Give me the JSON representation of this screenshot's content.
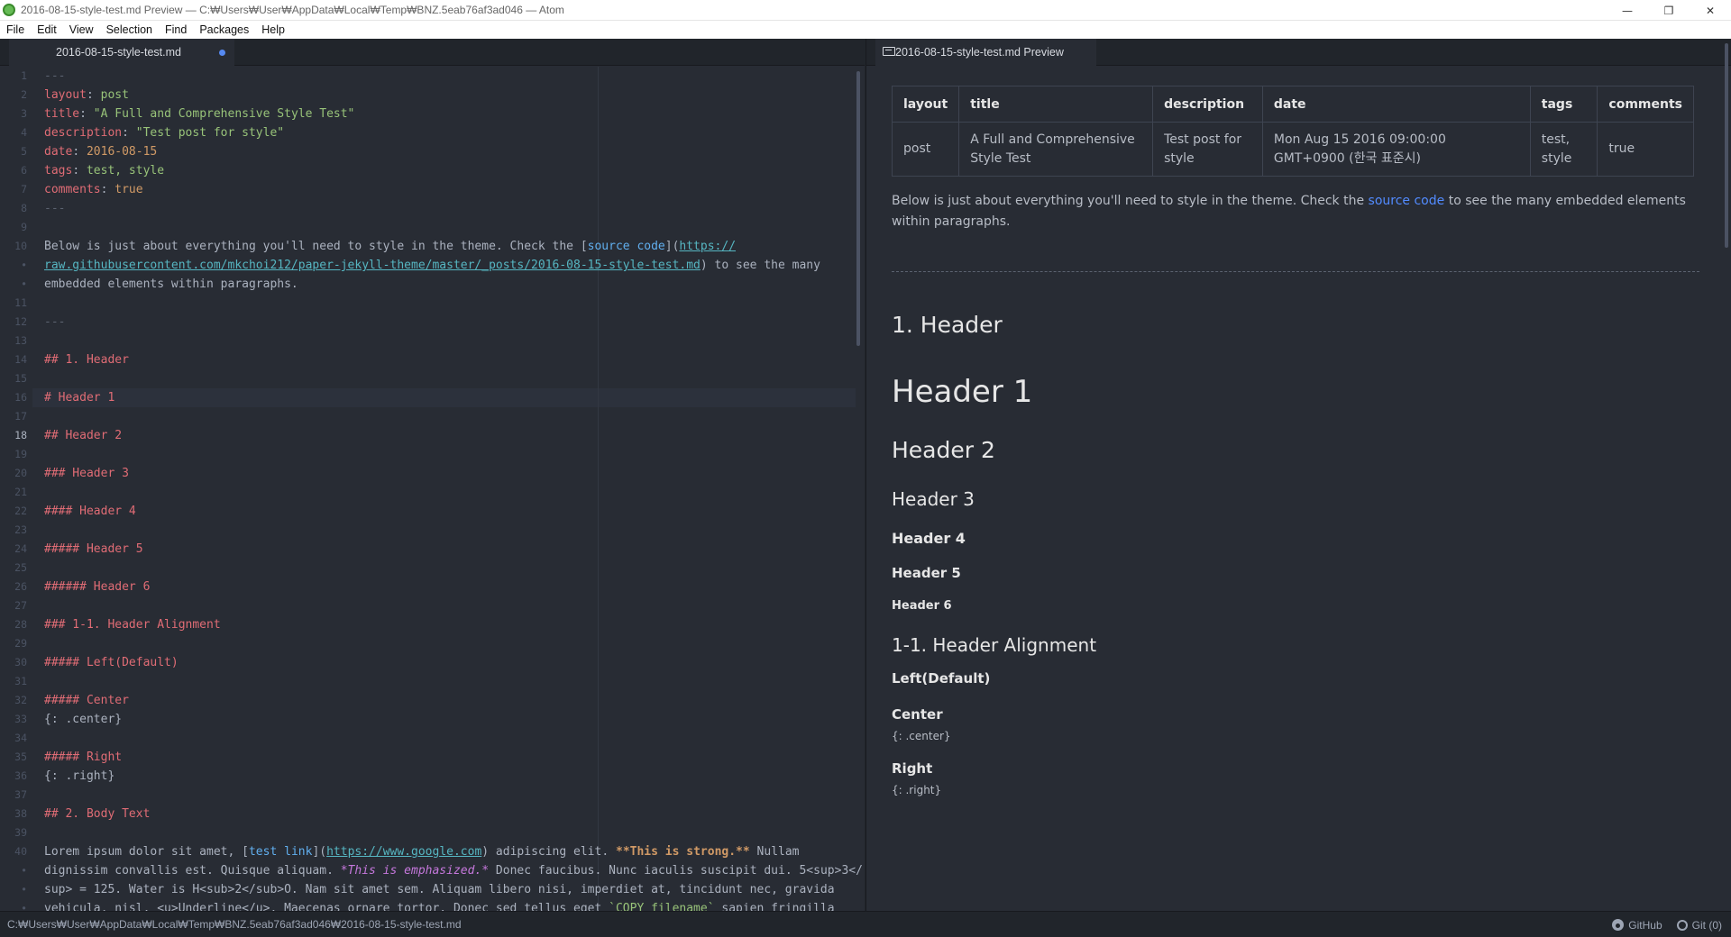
{
  "window": {
    "title": "2016-08-15-style-test.md Preview — C:₩Users₩User₩AppData₩Local₩Temp₩BNZ.5eab76af3ad046 — Atom",
    "minimize": "—",
    "restore": "❐",
    "close": "✕"
  },
  "menu": [
    "File",
    "Edit",
    "View",
    "Selection",
    "Find",
    "Packages",
    "Help"
  ],
  "editor_tab": {
    "label": "2016-08-15-style-test.md"
  },
  "preview_tab": {
    "label": "2016-08-15-style-test.md Preview"
  },
  "gutter": {
    "numbers": [
      "1",
      "2",
      "3",
      "4",
      "5",
      "6",
      "7",
      "8",
      "9",
      "10",
      "•",
      "•",
      "11",
      "12",
      "13",
      "14",
      "15",
      "16",
      "17",
      "18",
      "19",
      "20",
      "21",
      "22",
      "23",
      "24",
      "25",
      "26",
      "27",
      "28",
      "29",
      "30",
      "31",
      "32",
      "33",
      "34",
      "35",
      "36",
      "37",
      "38",
      "39",
      "40",
      "•",
      "•",
      "•"
    ],
    "current": "18"
  },
  "code": {
    "l1": "---",
    "l2_key": "layout",
    "l2_val": "post",
    "l3_key": "title",
    "l3_val": "\"A Full and Comprehensive Style Test\"",
    "l4_key": "description",
    "l4_val": "\"Test post for style\"",
    "l5_key": "date",
    "l5_val": "2016-08-15",
    "l6_key": "tags",
    "l6_val": "test, style",
    "l7_key": "comments",
    "l7_val": "true",
    "l8": "---",
    "l10_a": "Below is just about everything you'll need to style in the theme. Check the [",
    "l10_link": "source code",
    "l10_b": "](",
    "l10_url1": "https://",
    "l10_url2": "raw.githubusercontent.com/mkchoi212/paper-jekyll-theme/master/_posts/2016-08-15-style-test.md",
    "l10_c": ") to see the many",
    "l10_d": "embedded elements within paragraphs.",
    "l12": "---",
    "l14": "## 1. Header",
    "l16": "# Header 1",
    "l18": "## Header 2",
    "l20": "### Header 3",
    "l22": "#### Header 4",
    "l24": "##### Header 5",
    "l26": "###### Header 6",
    "l28": "### 1-1. Header Alignment",
    "l30": "##### Left(Default)",
    "l32": "##### Center",
    "l33": "{: .center}",
    "l35": "##### Right",
    "l36": "{: .right}",
    "l38": "## 2. Body Text",
    "l40_a": "Lorem ipsum dolor sit amet, [",
    "l40_link": "test link",
    "l40_b": "](",
    "l40_url": "https://www.google.com",
    "l40_c": ") adipiscing elit. ",
    "l40_strong": "**This is strong.**",
    "l40_d": " Nullam",
    "l41_a": "dignissim convallis est. Quisque aliquam. ",
    "l41_em": "*This is emphasized.*",
    "l41_b": " Donec faucibus. Nunc iaculis suscipit dui. 5<sup>3</",
    "l42": "sup> = 125. Water is H<sub>2</sub>O. Nam sit amet sem. Aliquam libero nisi, imperdiet at, tincidunt nec, gravida",
    "l43_a": "vehicula, nisl. <u>Underline</u>. Maecenas ornare tortor. Donec sed tellus eget ",
    "l43_code": "`COPY filename`",
    "l43_b": " sapien fringilla"
  },
  "preview": {
    "table": {
      "headers": [
        "layout",
        "title",
        "description",
        "date",
        "tags",
        "comments"
      ],
      "row": {
        "layout": "post",
        "title": "A Full and Comprehensive Style Test",
        "description": "Test post for style",
        "date": "Mon Aug 15 2016 09:00:00 GMT+0900 (한국 표준시)",
        "tags": "test, style",
        "comments": "true"
      }
    },
    "para_a": "Below is just about everything you'll need to style in the theme. Check the ",
    "para_link": "source code",
    "para_b": " to see the many embedded elements within paragraphs.",
    "h_section1": "1. Header",
    "h1": "Header 1",
    "h2": "Header 2",
    "h3": "Header 3",
    "h4": "Header 4",
    "h5": "Header 5",
    "h6": "Header 6",
    "h_align": "1-1. Header Alignment",
    "left": "Left(Default)",
    "center": "Center",
    "center_attr": "{: .center}",
    "right": "Right",
    "right_attr": "{: .right}"
  },
  "status": {
    "path": "C:₩Users₩User₩AppData₩Local₩Temp₩BNZ.5eab76af3ad046₩2016-08-15-style-test.md",
    "github": "GitHub",
    "git": "Git (0)"
  },
  "colors": {
    "editor_bg": "#282c34",
    "accent": "#568af2",
    "link": "#528bff"
  }
}
